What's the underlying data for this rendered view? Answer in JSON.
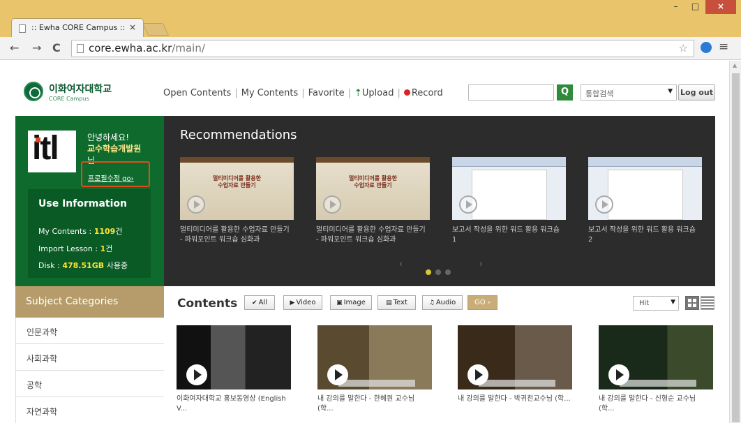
{
  "browser": {
    "tab_title": ":: Ewha CORE Campus :: ",
    "tab_close": "×",
    "url_domain": "core.ewha.ac.kr",
    "url_path": "/main/",
    "win_min": "–",
    "win_max": "□",
    "win_close": "×",
    "back": "←",
    "forward": "→",
    "reload": "C",
    "star": "☆",
    "menu": "≡"
  },
  "header": {
    "logo_kr": "이화여자대학교",
    "logo_en": "CORE Campus",
    "nav": {
      "open_contents": "Open Contents",
      "my_contents": "My Contents",
      "favorite": "Favorite",
      "upload": "Upload",
      "record": "Record",
      "sep": "|"
    },
    "search_button": "Q",
    "search_scope": "통합검색",
    "logout": "Log out"
  },
  "user": {
    "greeting": "안녕하세요!",
    "name": "교수학습개발원",
    "honorific": "님",
    "profile_link": "프로필수정 go›",
    "use_info": {
      "title": "Use Information",
      "my_contents_label": "My Contents : ",
      "my_contents_value": "1109",
      "my_contents_unit": "건",
      "import_label": "Import Lesson : ",
      "import_value": "1",
      "import_unit": "건",
      "disk_label": "Disk : ",
      "disk_value": "478.51GB",
      "disk_unit": " 사용중"
    }
  },
  "recommendations": {
    "title": "Recommendations",
    "slide_text_1": "멀티미디어를 활용한\n수업자료 만들기",
    "slide_text_2": "멀티미디어를 활용한\n수업자료 만들기",
    "items": [
      {
        "label": "멀티미디어를 활용한 수업자료 만들기 - 파워포인트 워크숍 심화과"
      },
      {
        "label": "멀티미디어를 활용한 수업자료 만들기 - 파워포인트 워크숍 심화과"
      },
      {
        "label": "보고서 작성을 위한 워드 활용 워크숍 1"
      },
      {
        "label": "보고서 작성을 위한 워드 활용 워크숍 2"
      }
    ],
    "prev": "‹",
    "next": "›",
    "active_page": 1,
    "page_count": 3
  },
  "subjects": {
    "title": "Subject Categories",
    "items": [
      "인문과학",
      "사회과학",
      "공학",
      "자연과학"
    ]
  },
  "contents": {
    "title": "Contents",
    "filters": {
      "all": "All",
      "video": "Video",
      "image": "Image",
      "text": "Text",
      "audio": "Audio",
      "go": "GO ›"
    },
    "sort": "Hit",
    "items": [
      {
        "label": "이화여자대학교 홍보동영상 (English V..."
      },
      {
        "label": "내 강의를 말한다 - 한혜원 교수님 (학..."
      },
      {
        "label": "내 강의를 말한다 - 박귀천교수님 (학..."
      },
      {
        "label": "내 강의를 말한다 - 신형순 교수님 (학..."
      }
    ]
  },
  "colors": {
    "brand_green": "#0f6b2d",
    "highlight_yellow": "#ffe234",
    "category_gold": "#b59c6a",
    "profile_box": "#e64a1c"
  }
}
